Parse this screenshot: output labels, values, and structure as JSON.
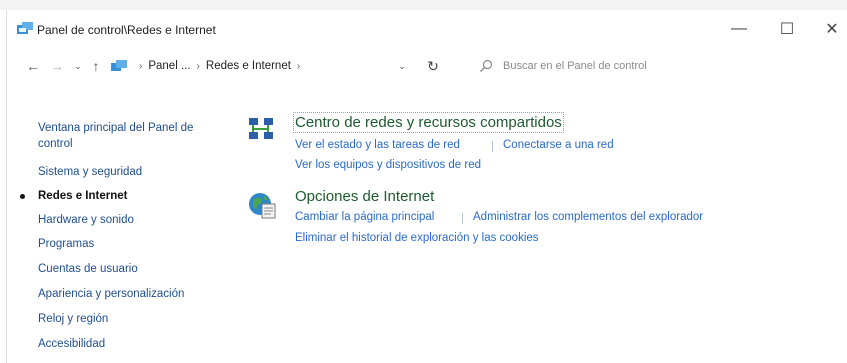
{
  "window": {
    "title": "Panel de control\\Redes e Internet",
    "controls": {
      "minimize": "—",
      "maximize": "☐",
      "close": "✕"
    }
  },
  "addressbar": {
    "back": "←",
    "forward": "→",
    "recent": "⌄",
    "up": "↑",
    "breadcrumb": [
      "Panel ...",
      "Redes e Internet"
    ],
    "separator": "›",
    "dropdown": "⌄",
    "refresh": "↻",
    "search_placeholder": "Buscar en el Panel de control"
  },
  "leftnav": {
    "items": [
      {
        "label": "Ventana principal del Panel de"
      },
      {
        "label": "control"
      },
      {
        "label": "Sistema y seguridad"
      },
      {
        "label": "Redes e Internet",
        "active": true
      },
      {
        "label": "Hardware y sonido"
      },
      {
        "label": "Programas"
      },
      {
        "label": "Cuentas de usuario"
      },
      {
        "label": "Apariencia y personalización"
      },
      {
        "label": "Reloj y región"
      },
      {
        "label": "Accesibilidad"
      }
    ]
  },
  "categories": [
    {
      "icon": "network-sharing-center-icon",
      "title": "Centro de redes y recursos compartidos",
      "links": [
        "Ver el estado y las tareas de red",
        "Conectarse a una red",
        "Ver los equipos y dispositivos de red"
      ]
    },
    {
      "icon": "internet-options-icon",
      "title": "Opciones de Internet",
      "links": [
        "Cambiar la página principal",
        "Administrar los complementos del explorador",
        "Eliminar el historial de exploración y las cookies"
      ]
    }
  ],
  "colors": {
    "link": "#2a6ac8",
    "category_title": "#1e5a2e",
    "nav_link": "#1f4e8c"
  }
}
